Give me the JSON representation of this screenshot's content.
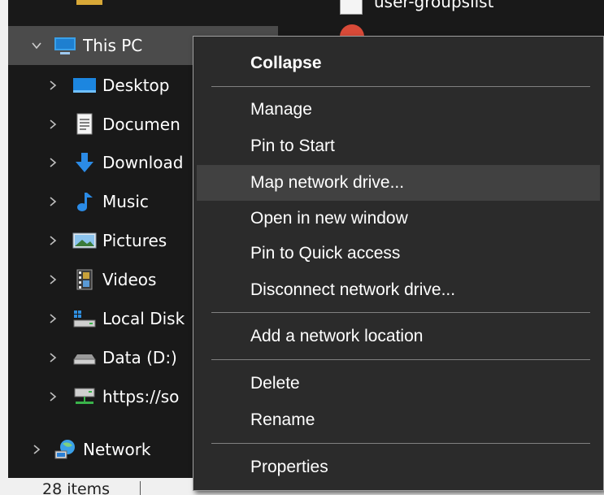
{
  "nav_tree": {
    "items": [
      {
        "label": "This PC",
        "icon": "this-pc-icon",
        "expanded": true,
        "selected": true
      },
      {
        "label": "Desktop",
        "icon": "desktop-folder-icon"
      },
      {
        "label": "Documen",
        "icon": "documents-folder-icon"
      },
      {
        "label": "Download",
        "icon": "downloads-folder-icon"
      },
      {
        "label": "Music",
        "icon": "music-folder-icon"
      },
      {
        "label": "Pictures",
        "icon": "pictures-folder-icon"
      },
      {
        "label": "Videos",
        "icon": "videos-folder-icon"
      },
      {
        "label": "Local Disk",
        "icon": "local-disk-icon"
      },
      {
        "label": "Data (D:)",
        "icon": "drive-icon"
      },
      {
        "label": "https://so",
        "icon": "network-drive-icon"
      },
      {
        "label": "Network",
        "icon": "network-icon"
      }
    ]
  },
  "content": {
    "files": [
      {
        "label": "user-groupslist",
        "icon": "file-icon"
      },
      {
        "label": "",
        "icon": "app-icon"
      }
    ]
  },
  "status_bar": {
    "items_count": "28 items"
  },
  "context_menu": {
    "items": [
      {
        "label": "Collapse",
        "bold": true
      },
      {
        "label": "Manage"
      },
      {
        "label": "Pin to Start"
      },
      {
        "label": "Map network drive...",
        "hovered": true
      },
      {
        "label": "Open in new window"
      },
      {
        "label": "Pin to Quick access"
      },
      {
        "label": "Disconnect network drive..."
      },
      {
        "label": "Add a network location"
      },
      {
        "label": "Delete"
      },
      {
        "label": "Rename"
      },
      {
        "label": "Properties"
      }
    ]
  },
  "colors": {
    "pane_background": "#191919",
    "menu_background": "#2b2b2b",
    "menu_hover": "#414141",
    "selected_row": "#4b4b4b",
    "status_background": "#f0f0f0"
  }
}
